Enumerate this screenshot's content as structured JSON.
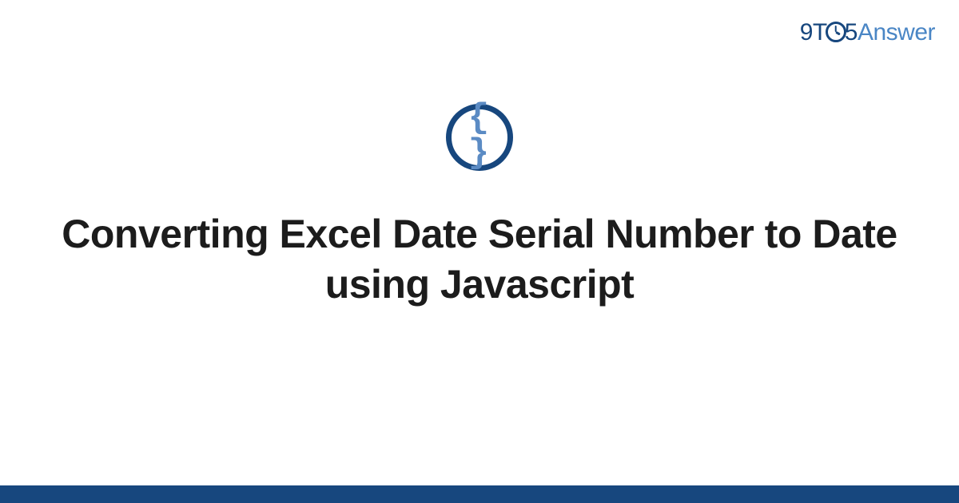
{
  "logo": {
    "part1": "9T",
    "part2": "5",
    "part3": "Answer"
  },
  "icon": {
    "braces": "{ }"
  },
  "title": "Converting Excel Date Serial Number to Date using Javascript"
}
